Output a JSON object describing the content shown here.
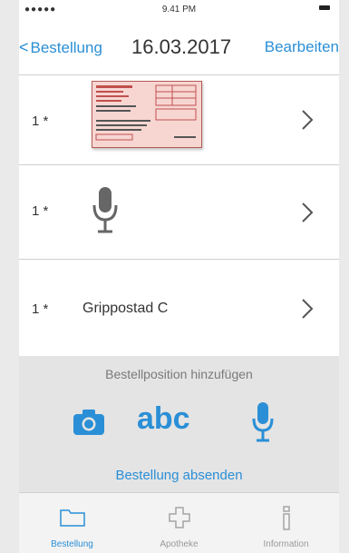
{
  "statusbar": {
    "signal": "●●●●● ",
    "time": "9.41 PM"
  },
  "nav": {
    "back_label": "Bestellung",
    "title": "16.03.2017",
    "edit_label": "Bearbeiten"
  },
  "items": [
    {
      "qty": "1 *",
      "type": "prescription-image",
      "icon": "prescription-image"
    },
    {
      "qty": "1 *",
      "type": "voice-memo",
      "icon": "microphone-icon"
    },
    {
      "qty": "1 *",
      "type": "text",
      "name": "Grippostad C"
    }
  ],
  "actions": {
    "add_label": "Bestellposition hinzufügen",
    "text_label": "abc",
    "send_label": "Bestellung absenden"
  },
  "tabs": [
    {
      "label": "Bestellung",
      "icon": "folder-icon",
      "active": true
    },
    {
      "label": "Apotheke",
      "icon": "cross-icon",
      "active": false
    },
    {
      "label": "Information",
      "icon": "info-icon",
      "active": false
    }
  ],
  "colors": {
    "accent": "#2a8fd6",
    "text": "#333333",
    "muted": "#9a9a9a"
  }
}
